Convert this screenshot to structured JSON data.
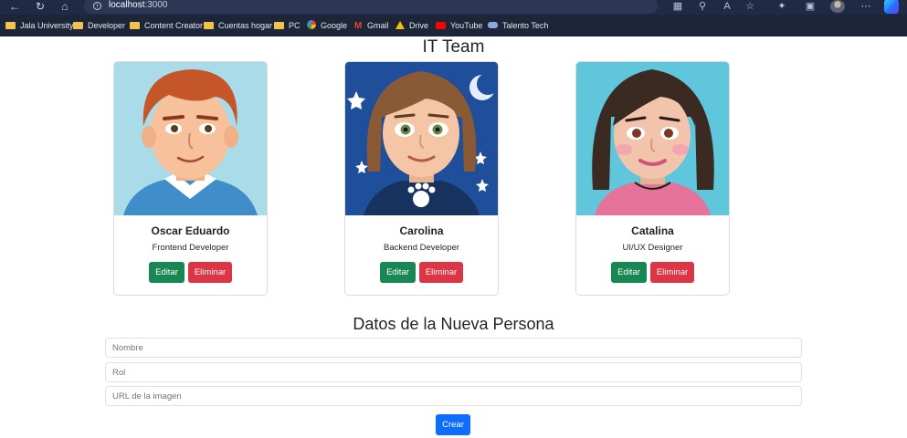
{
  "browser": {
    "url_host": "localhost",
    "url_port": ":3000",
    "bookmarks": [
      {
        "label": "Jala University",
        "icon": "folder-icon"
      },
      {
        "label": "Developer",
        "icon": "folder-icon"
      },
      {
        "label": "Content Creator",
        "icon": "folder-icon"
      },
      {
        "label": "Cuentas hogar",
        "icon": "folder-icon"
      },
      {
        "label": "PC",
        "icon": "folder-icon"
      },
      {
        "label": "Google",
        "icon": "google-icon"
      },
      {
        "label": "Gmail",
        "icon": "gmail-icon"
      },
      {
        "label": "Drive",
        "icon": "drive-icon"
      },
      {
        "label": "YouTube",
        "icon": "youtube-icon"
      },
      {
        "label": "Talento Tech",
        "icon": "talento-tech-icon"
      }
    ]
  },
  "page": {
    "title": "IT Team",
    "members": [
      {
        "name": "Oscar Eduardo",
        "role": "Frontend Developer",
        "edit_label": "Editar",
        "delete_label": "Eliminar",
        "avatar": "male-avatar-red-hair"
      },
      {
        "name": "Carolina",
        "role": "Backend Developer",
        "edit_label": "Editar",
        "delete_label": "Eliminar",
        "avatar": "female-avatar-brown-hair"
      },
      {
        "name": "Catalina",
        "role": "UI/UX Designer",
        "edit_label": "Editar",
        "delete_label": "Eliminar",
        "avatar": "female-avatar-dark-hair"
      }
    ],
    "form": {
      "title": "Datos de la Nueva Persona",
      "name_placeholder": "Nombre",
      "role_placeholder": "Rol",
      "image_placeholder": "URL de la imagen",
      "create_label": "Crear"
    }
  },
  "colors": {
    "success": "#198754",
    "danger": "#dc3545",
    "primary": "#0d6efd"
  }
}
